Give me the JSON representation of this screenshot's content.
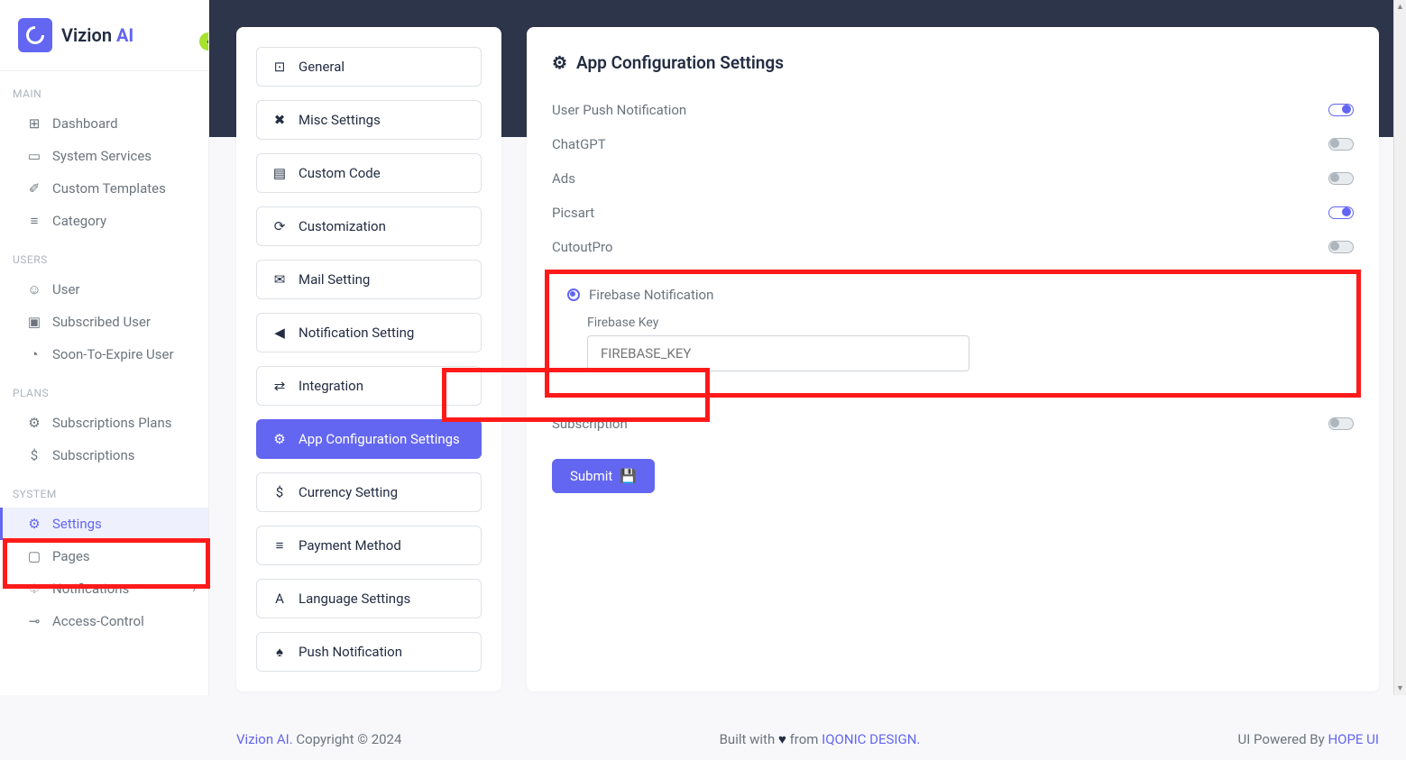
{
  "brand": {
    "name_a": "Vizion ",
    "name_b": "AI"
  },
  "sidebar": {
    "sections": {
      "main": {
        "heading": "MAIN",
        "items": [
          {
            "icon": "⊞",
            "label": "Dashboard"
          },
          {
            "icon": "▭",
            "label": "System Services"
          },
          {
            "icon": "✐",
            "label": "Custom Templates"
          },
          {
            "icon": "≡",
            "label": "Category"
          }
        ]
      },
      "users": {
        "heading": "USERS",
        "items": [
          {
            "icon": "☺",
            "label": "User"
          },
          {
            "icon": "▣",
            "label": "Subscribed User"
          },
          {
            "icon": "◔",
            "label": "Soon-To-Expire User"
          }
        ]
      },
      "plans": {
        "heading": "PLANS",
        "items": [
          {
            "icon": "⚙",
            "label": "Subscriptions Plans"
          },
          {
            "icon": "$",
            "label": "Subscriptions"
          }
        ]
      },
      "system": {
        "heading": "SYSTEM",
        "items": [
          {
            "icon": "⚙",
            "label": "Settings",
            "active": true
          },
          {
            "icon": "▢",
            "label": "Pages"
          },
          {
            "icon": "♤",
            "label": "Notifications",
            "chev": true
          },
          {
            "icon": "⊸",
            "label": "Access-Control"
          }
        ]
      }
    }
  },
  "tabs": [
    {
      "icon": "⊡",
      "label": "General"
    },
    {
      "icon": "✖",
      "label": "Misc Settings"
    },
    {
      "icon": "▤",
      "label": "Custom Code"
    },
    {
      "icon": "⟳",
      "label": "Customization"
    },
    {
      "icon": "✉",
      "label": "Mail Setting"
    },
    {
      "icon": "◀",
      "label": "Notification Setting"
    },
    {
      "icon": "⇄",
      "label": "Integration"
    },
    {
      "icon": "⚙",
      "label": "App Configuration Settings",
      "active": true
    },
    {
      "icon": "$",
      "label": "Currency Setting"
    },
    {
      "icon": "≡",
      "label": "Payment Method"
    },
    {
      "icon": "A",
      "label": "Language Settings"
    },
    {
      "icon": "♠",
      "label": "Push Notification"
    }
  ],
  "form": {
    "title": "App Configuration Settings",
    "options": [
      {
        "label": "User Push Notification",
        "on": true
      },
      {
        "label": "ChatGPT",
        "on": false
      },
      {
        "label": "Ads",
        "on": false
      },
      {
        "label": "Picsart",
        "on": true
      },
      {
        "label": "CutoutPro",
        "on": false
      }
    ],
    "firebase": {
      "label": "Firebase Notification",
      "keylabel": "Firebase Key",
      "placeholder": "FIREBASE_KEY"
    },
    "subscription": {
      "label": "Subscription",
      "on": false
    },
    "submit": "Submit"
  },
  "footer": {
    "brand": "Vizion AI.",
    "copy": " Copyright © 2024",
    "built_a": "Built with ",
    "built_b": " from ",
    "iqonic": "IQONIC DESIGN.",
    "pow_a": "UI Powered By ",
    "hope": "HOPE UI"
  }
}
